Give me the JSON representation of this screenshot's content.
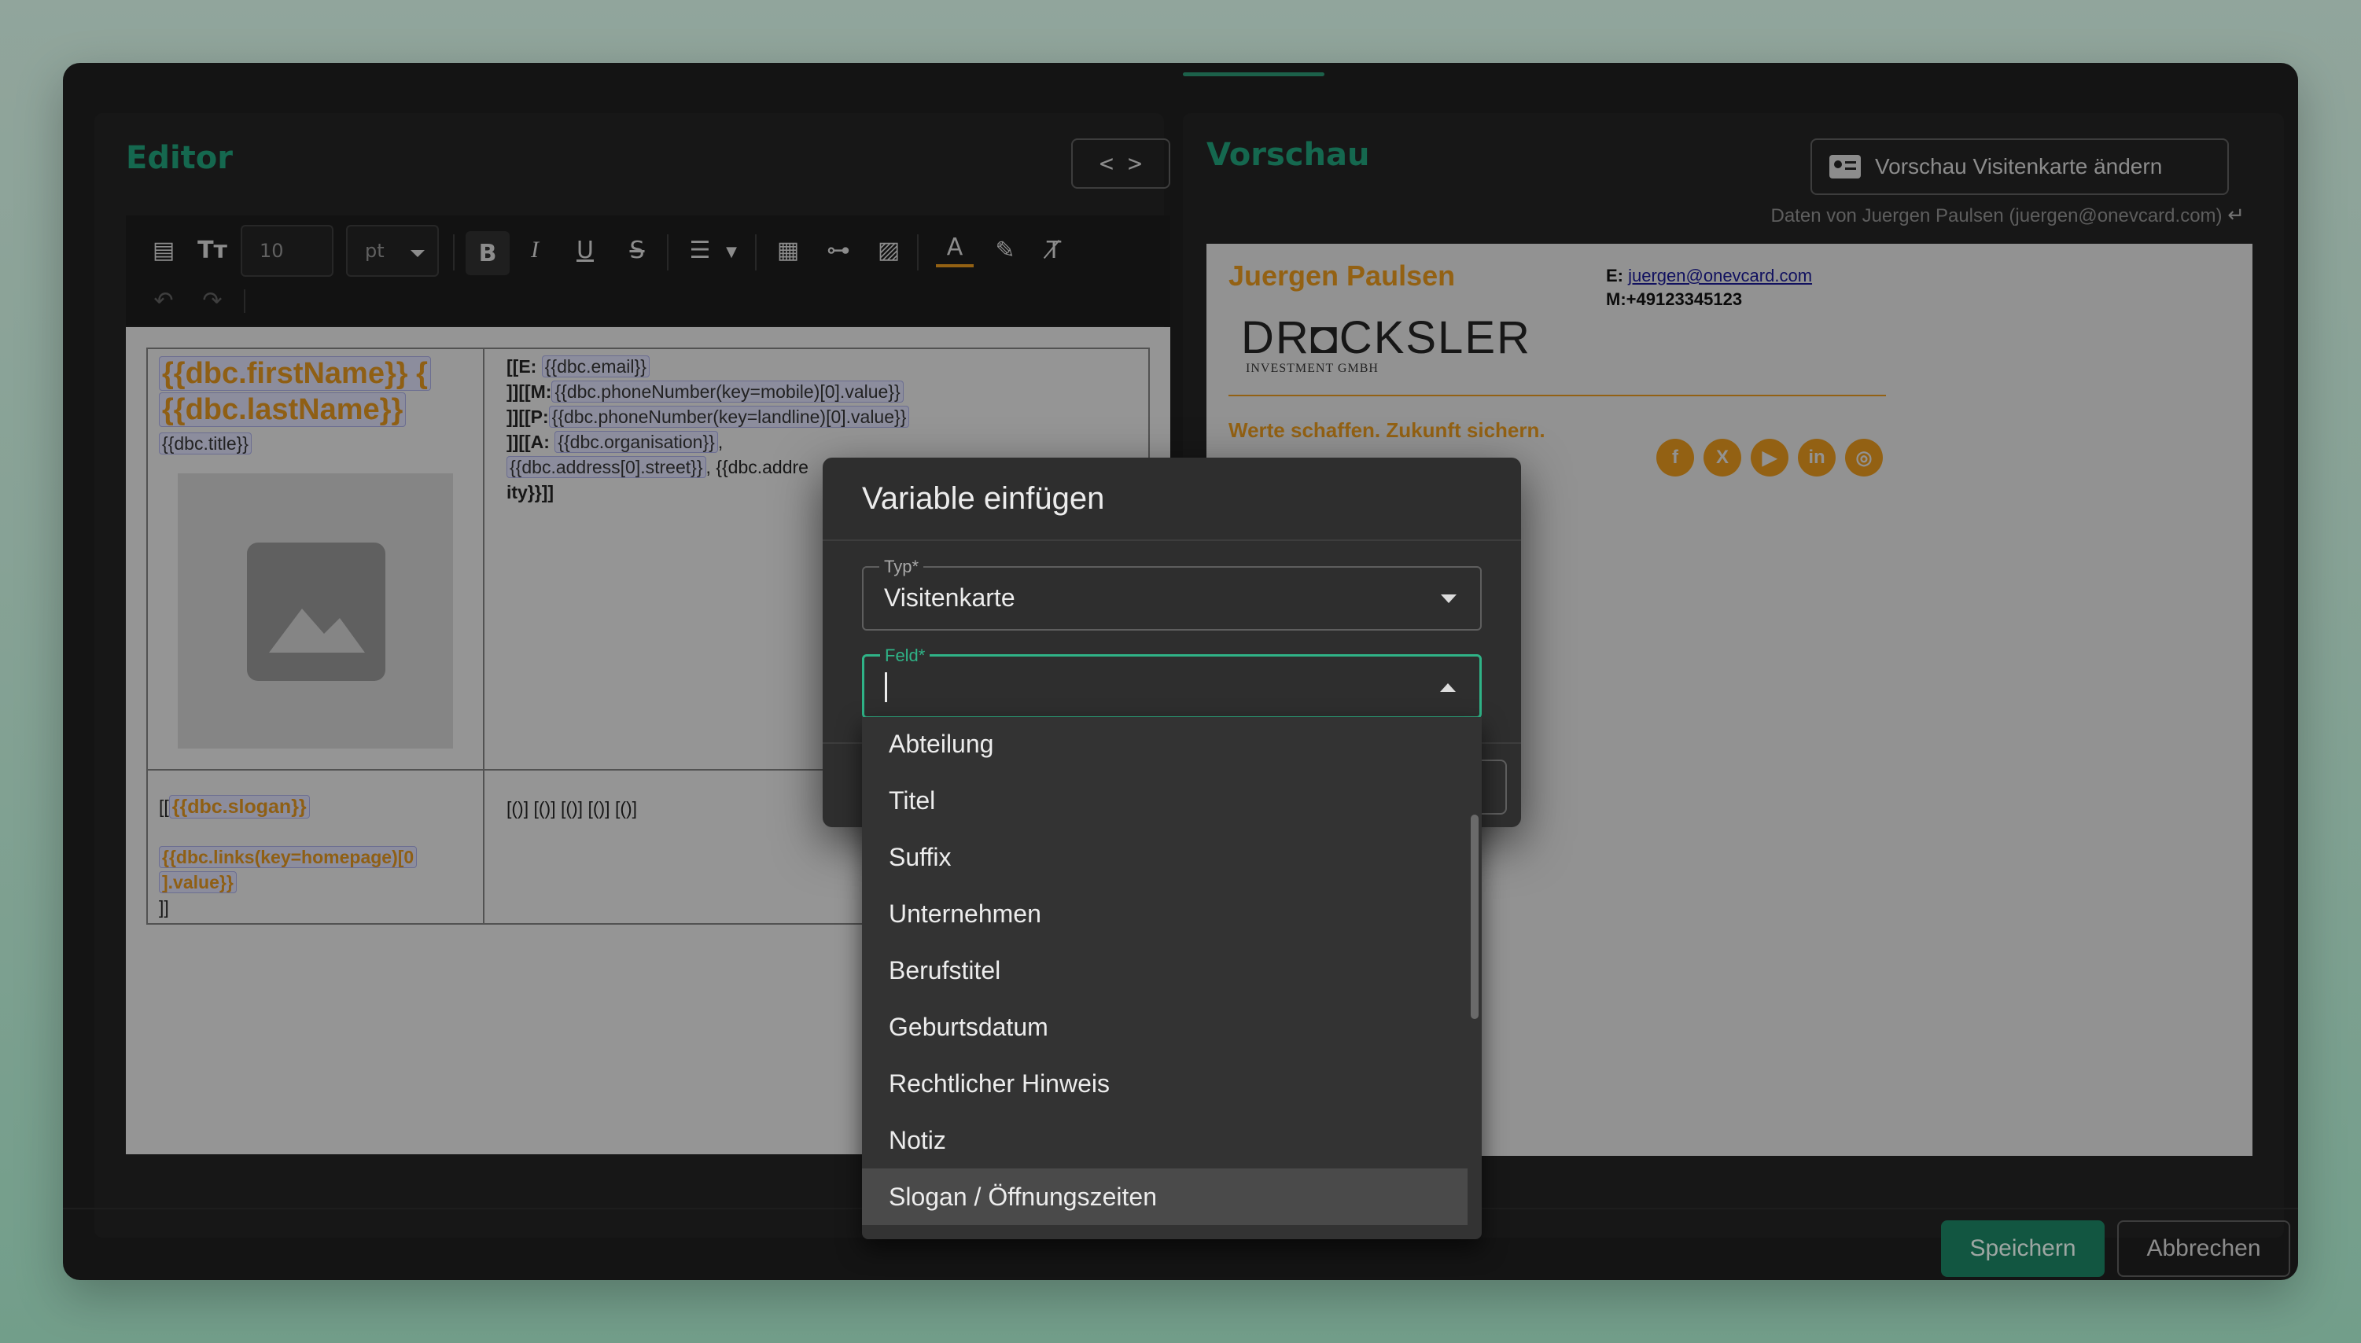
{
  "editor": {
    "title": "Editor",
    "code_button": "< >",
    "font_size": "10",
    "font_unit": "pt",
    "doc": {
      "first_name_var": "{{dbc.firstName}} {",
      "last_name_var": "{{dbc.lastName}}",
      "title_var": "{{dbc.title}}",
      "contact_lines": [
        {
          "prefix": "[[E: ",
          "var": "{{dbc.email}}",
          "suffix": ""
        },
        {
          "prefix": "]][[M:",
          "var": "{{dbc.phoneNumber(key=mobile)[0].value}}",
          "suffix": ""
        },
        {
          "prefix": "]][[P:",
          "var": "{{dbc.phoneNumber(key=landline)[0].value}}",
          "suffix": ""
        },
        {
          "prefix": "]][[A: ",
          "var": "{{dbc.organisation}}",
          "suffix": ","
        },
        {
          "prefix": " ",
          "var": "{{dbc.address[0].street}}",
          "suffix": ", {{dbc.addre"
        },
        {
          "prefix": "ity}}]]",
          "var": "",
          "suffix": ""
        }
      ],
      "slogan_prefix": "[[",
      "slogan_var": "{{dbc.slogan}}",
      "homepage_var_1": "{{dbc.links(key=homepage)[0",
      "homepage_var_2": "].value}}",
      "homepage_close": "]]",
      "social_placeholders": "[()] [()] [()] [()] [()]"
    }
  },
  "preview": {
    "title": "Vorschau",
    "change_button": "Vorschau Visitenkarte ändern",
    "data_source": "Daten von Juergen Paulsen (juergen@onevcard.com)",
    "card": {
      "name": "Juergen Paulsen",
      "email_label": "E:",
      "email": "juergen@onevcard.com",
      "mobile": "M:+49123345123",
      "logo": "DR◘CKSLER",
      "logo_sub": "INVESTMENT GMBH",
      "slogan": "Werte schaffen. Zukunft sichern.",
      "social": [
        {
          "name": "facebook-icon",
          "glyph": "f"
        },
        {
          "name": "x-icon",
          "glyph": "X"
        },
        {
          "name": "youtube-icon",
          "glyph": "▶"
        },
        {
          "name": "linkedin-icon",
          "glyph": "in"
        },
        {
          "name": "instagram-icon",
          "glyph": "◎"
        }
      ]
    }
  },
  "footer": {
    "save": "Speichern",
    "cancel": "Abbrechen"
  },
  "dialog": {
    "title": "Variable einfügen",
    "type_label": "Typ*",
    "type_value": "Visitenkarte",
    "field_label": "Feld*",
    "field_value": "",
    "options": [
      "Abteilung",
      "Titel",
      "Suffix",
      "Unternehmen",
      "Berufstitel",
      "Geburtsdatum",
      "Rechtlicher Hinweis",
      "Notiz",
      "Slogan / Öffnungszeiten"
    ],
    "highlighted_option": "Slogan / Öffnungszeiten"
  },
  "colors": {
    "accent": "#1f9a75",
    "focus": "#2fb387",
    "variable_orange": "#d9901d",
    "save_button": "#1b7f61"
  }
}
